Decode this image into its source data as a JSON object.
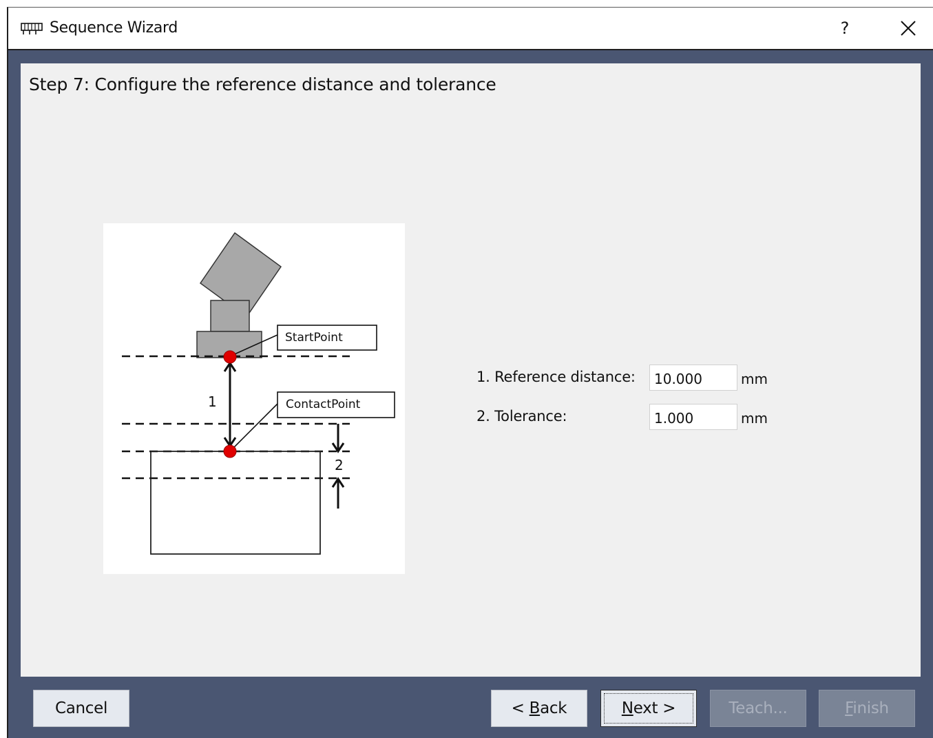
{
  "window": {
    "title": "Sequence Wizard",
    "help_label": "?"
  },
  "step": {
    "heading": "Step 7: Configure the reference distance and tolerance"
  },
  "diagram": {
    "start_point_label": "StartPoint",
    "contact_point_label": "ContactPoint",
    "marker_1": "1",
    "marker_2": "2"
  },
  "form": {
    "reference_distance_label": "1. Reference distance:",
    "reference_distance_value": "10.000",
    "reference_distance_unit": "mm",
    "tolerance_label": "2. Tolerance:",
    "tolerance_value": "1.000",
    "tolerance_unit": "mm"
  },
  "buttons": {
    "cancel": "Cancel",
    "back_prefix": "< ",
    "back_mnemonic": "B",
    "back_rest": "ack",
    "next_mnemonic": "N",
    "next_rest": "ext >",
    "teach": "Teach...",
    "finish_mnemonic": "F",
    "finish_rest": "inish"
  }
}
